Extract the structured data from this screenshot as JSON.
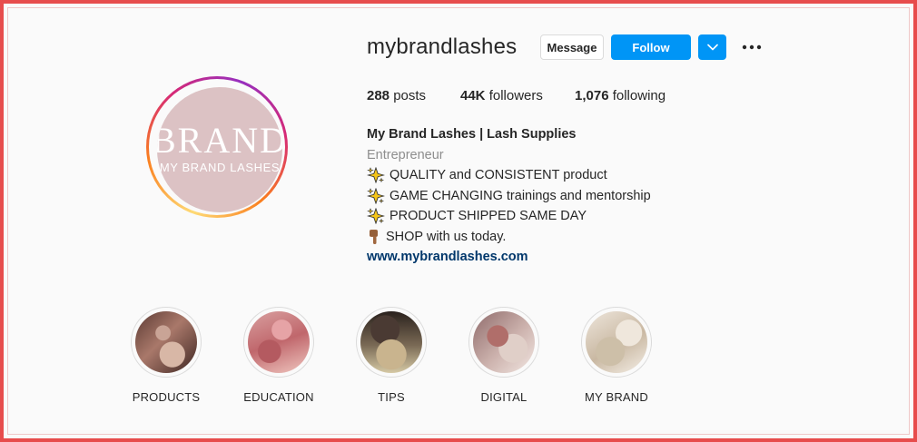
{
  "profile": {
    "username": "mybrandlashes",
    "avatar_logo": "BRAND",
    "avatar_sub": "MY BRAND LASHES"
  },
  "actions": {
    "message_label": "Message",
    "follow_label": "Follow",
    "dropdown_icon": "chevron-down-icon",
    "more_icon": "more-options-icon"
  },
  "stats": {
    "posts_count": "288",
    "posts_label": "posts",
    "followers_count": "44K",
    "followers_label": "followers",
    "following_count": "1,076",
    "following_label": "following"
  },
  "bio": {
    "name": "My Brand Lashes | Lash Supplies",
    "category": "Entrepreneur",
    "lines": [
      {
        "icon": "sparkles-icon",
        "text": "QUALITY and CONSISTENT product"
      },
      {
        "icon": "sparkles-icon",
        "text": "GAME CHANGING trainings and mentorship"
      },
      {
        "icon": "sparkles-icon",
        "text": "PRODUCT SHIPPED SAME DAY"
      },
      {
        "icon": "pointing-down-icon",
        "text": "SHOP with us today."
      }
    ],
    "link": "www.mybrandlashes.com"
  },
  "highlights": [
    {
      "label": "PRODUCTS"
    },
    {
      "label": "EDUCATION"
    },
    {
      "label": "TIPS"
    },
    {
      "label": "DIGITAL"
    },
    {
      "label": "MY BRAND"
    }
  ],
  "colors": {
    "accent": "#0095f6",
    "frame": "#e74c4c",
    "link": "#00376b",
    "avatar_bg": "#dcc2c4"
  }
}
